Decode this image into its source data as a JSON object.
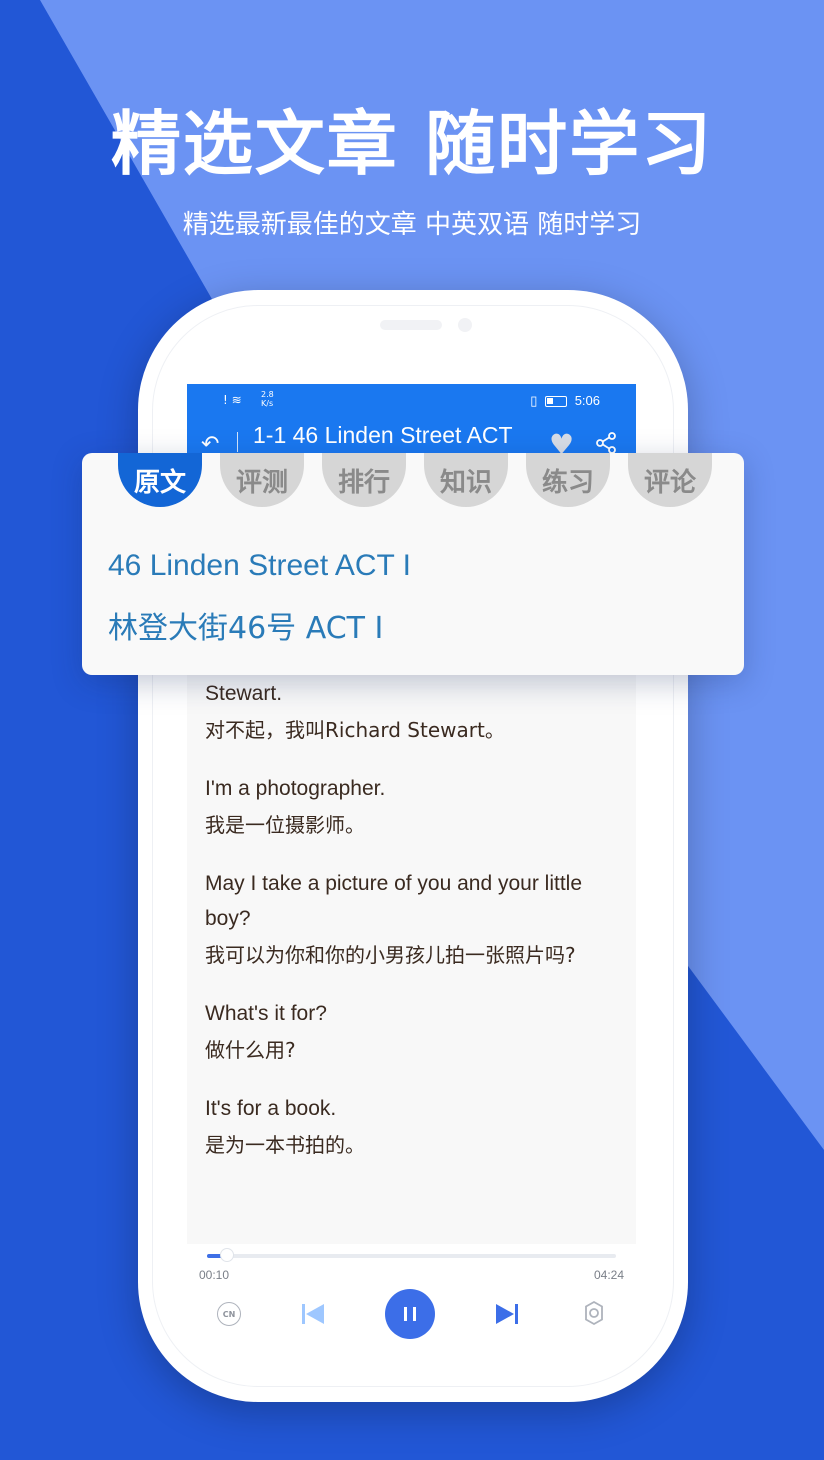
{
  "promo": {
    "headline": "精选文章 随时学习",
    "subline": "精选最新最佳的文章 中英双语 随时学习"
  },
  "status_bar": {
    "left_icons": "! ≋",
    "speed": "2.8\nK/s",
    "time": "5:06"
  },
  "app_bar": {
    "title": "1-1 46 Linden Street  ACT",
    "back_icon": "back-icon",
    "favorite_icon": "heart-icon",
    "share_icon": "share-icon"
  },
  "tabs": [
    {
      "label": "原文",
      "active": true
    },
    {
      "label": "评测",
      "active": false
    },
    {
      "label": "排行",
      "active": false
    },
    {
      "label": "知识",
      "active": false
    },
    {
      "label": "练习",
      "active": false
    },
    {
      "label": "评论",
      "active": false
    }
  ],
  "card": {
    "title_en": "46 Linden Street  ACT I",
    "title_cn": "林登大街46号 ACT I"
  },
  "paragraphs": [
    {
      "en": "Stewart.",
      "cn": "对不起，我叫Richard Stewart。"
    },
    {
      "en": "I'm a photographer.",
      "cn": "我是一位摄影师。"
    },
    {
      "en": "May I take a picture of you and your little boy?",
      "cn": "我可以为你和你的小男孩儿拍一张照片吗?"
    },
    {
      "en": "What's it for?",
      "cn": "做什么用?"
    },
    {
      "en": "It's for a book.",
      "cn": "是为一本书拍的。"
    }
  ],
  "player": {
    "current_time": "00:10",
    "total_time": "04:24",
    "progress_fraction": 0.04,
    "cn_label": "CN",
    "accent": "#3c6ee8"
  }
}
